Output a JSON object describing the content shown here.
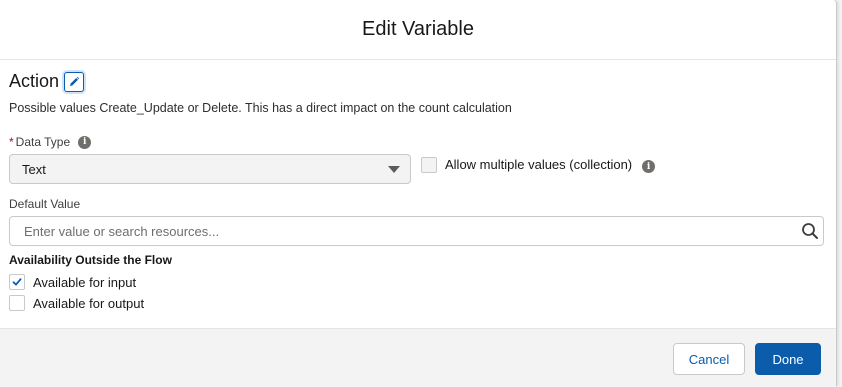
{
  "modal": {
    "title": "Edit Variable"
  },
  "variable": {
    "name": "Action",
    "description": "Possible values Create_Update or Delete. This has a direct impact on the count calculation"
  },
  "data_type": {
    "required_marker": "*",
    "label": "Data Type",
    "value": "Text"
  },
  "allow_multiple": {
    "label": "Allow multiple values (collection)",
    "checked": false
  },
  "default_value": {
    "label": "Default Value",
    "placeholder": "Enter value or search resources..."
  },
  "availability": {
    "heading": "Availability Outside the Flow",
    "input_label": "Available for input",
    "input_checked": true,
    "output_label": "Available for output",
    "output_checked": false
  },
  "footer": {
    "cancel_label": "Cancel",
    "done_label": "Done"
  },
  "icons": {
    "edit": "pencil-icon",
    "info": "info-icon",
    "dropdown": "chevron-down-icon",
    "search": "search-icon",
    "check": "checkmark-icon"
  },
  "colors": {
    "brand": "#0b5cab",
    "required": "#ba0517"
  }
}
